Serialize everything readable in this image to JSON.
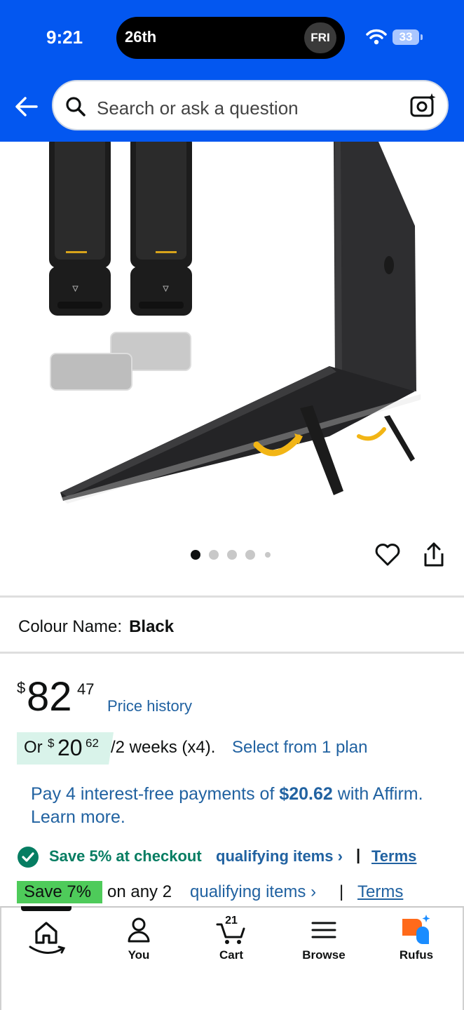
{
  "status_bar": {
    "time": "9:21",
    "island_date": "26th",
    "island_day": "FRI",
    "battery": "33"
  },
  "search": {
    "placeholder": "Search or ask a question"
  },
  "gallery": {
    "image_count": 5,
    "active_index": 0
  },
  "product": {
    "colour_label": "Colour Name:",
    "colour_value": "Black",
    "price_currency": "$",
    "price_whole": "82",
    "price_fraction": "47",
    "price_history": "Price history"
  },
  "installment": {
    "or": "Or",
    "currency": "$",
    "whole": "20",
    "fraction": "62",
    "period": "/2 weeks (x4).",
    "plan_link": "Select from 1 plan"
  },
  "affirm": {
    "text_before": "Pay 4 interest-free payments of ",
    "amount": "$20.62",
    "text_after": " with Affirm. Learn more."
  },
  "coupon": {
    "text": "Save 5% at checkout",
    "items_link": "qualifying items ›",
    "separator": "|",
    "terms": "Terms"
  },
  "promotion": {
    "badge": "Save 7%",
    "text": "on any 2",
    "items_link": "qualifying items ›",
    "separator": "|",
    "terms": "Terms"
  },
  "tabbar": {
    "home": "",
    "you": "You",
    "cart": "Cart",
    "cart_count": "21",
    "browse": "Browse",
    "rufus": "Rufus"
  },
  "colors": {
    "header": "#0357f0",
    "link": "#2162a1",
    "success": "#067d62",
    "promo_badge": "#4ecb5a",
    "rufus_orange": "#ff6a1a",
    "rufus_blue": "#1a8cff"
  }
}
